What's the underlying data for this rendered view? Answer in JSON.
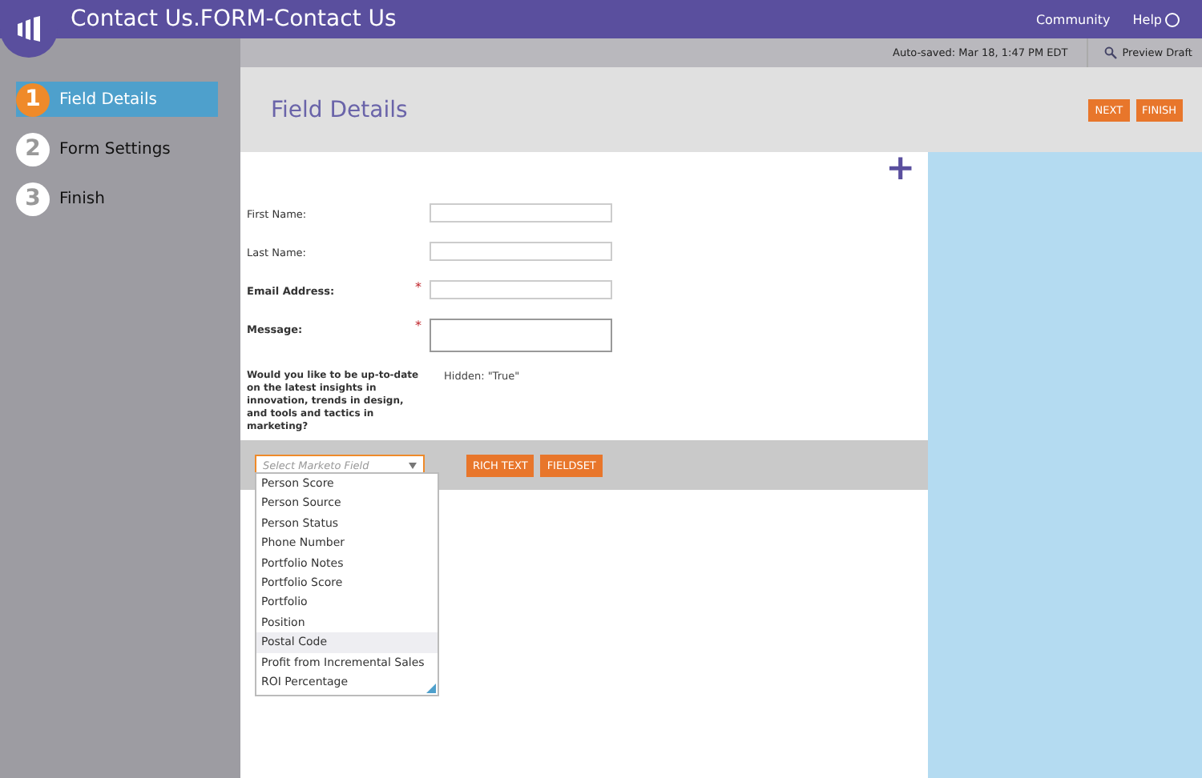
{
  "app_bar": {
    "title": "Contact Us.FORM-Contact Us",
    "links": [
      "Community",
      "Help"
    ]
  },
  "steps": [
    {
      "number": "1",
      "label": "Field Details",
      "selected": true
    },
    {
      "number": "2",
      "label": "Form Settings",
      "selected": false
    },
    {
      "number": "3",
      "label": "Finish",
      "selected": false
    }
  ],
  "status_bar": {
    "autosave": "Auto-saved: Mar 18, 1:47 PM EDT",
    "preview": "Preview Draft"
  },
  "header": {
    "title": "Field Details",
    "buttons": [
      "NEXT",
      "FINISH"
    ]
  },
  "form": {
    "add": "+",
    "fields": [
      {
        "label": "First Name:",
        "required": false,
        "kind": "input"
      },
      {
        "label": "Last Name:",
        "required": false,
        "kind": "input"
      },
      {
        "label": "Email Address:",
        "required": true,
        "kind": "input",
        "mark": "*"
      },
      {
        "label": "Message:",
        "required": true,
        "kind": "textarea",
        "mark": "*"
      },
      {
        "label": "Would you like to be up-to-date on the latest insights in innovation, trends in design, and tools and tactics in marketing?",
        "kind": "hidden",
        "value": "Hidden: \"True\""
      }
    ]
  },
  "toolbar": {
    "select": {
      "placeholder": "Select Marketo Field"
    },
    "buttons": [
      "RICH TEXT",
      "FIELDSET"
    ]
  },
  "dropdown": [
    {
      "label": "Person Score",
      "selected": false
    },
    {
      "label": "Person Source",
      "selected": false
    },
    {
      "label": "Person Status",
      "selected": false
    },
    {
      "label": "Phone Number",
      "selected": false
    },
    {
      "label": "Portfolio Notes",
      "selected": false
    },
    {
      "label": "Portfolio Score",
      "selected": false
    },
    {
      "label": "Portfolio",
      "selected": false
    },
    {
      "label": "Position",
      "selected": false
    },
    {
      "label": "Postal Code",
      "selected": true
    },
    {
      "label": "Profit from Incremental Sales",
      "selected": false
    },
    {
      "label": "ROI Percentage",
      "selected": false
    }
  ]
}
